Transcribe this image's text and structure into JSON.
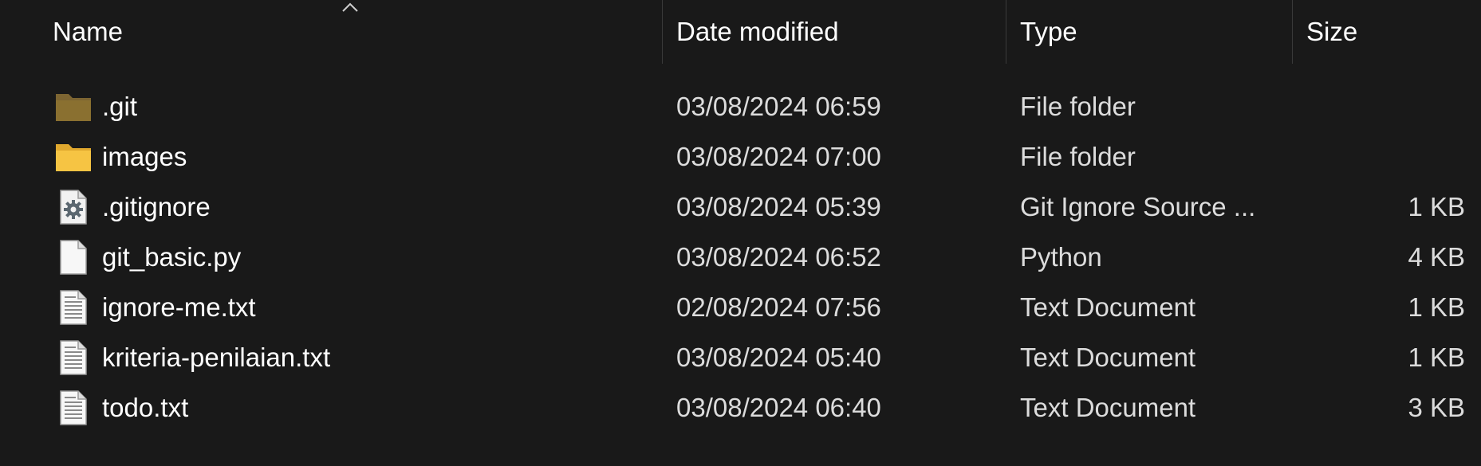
{
  "columns": {
    "name": "Name",
    "date": "Date modified",
    "type": "Type",
    "size": "Size"
  },
  "sort": {
    "column": "name",
    "direction": "ascending",
    "icon": "sort-up-chevron-icon"
  },
  "files": [
    {
      "name": ".git",
      "date": "03/08/2024 06:59",
      "type": "File folder",
      "size": "",
      "icon": "folder-dimmed-icon"
    },
    {
      "name": "images",
      "date": "03/08/2024 07:00",
      "type": "File folder",
      "size": "",
      "icon": "folder-icon"
    },
    {
      "name": ".gitignore",
      "date": "03/08/2024 05:39",
      "type": "Git Ignore Source ...",
      "size": "1 KB",
      "icon": "settings-file-icon"
    },
    {
      "name": "git_basic.py",
      "date": "03/08/2024 06:52",
      "type": "Python",
      "size": "4 KB",
      "icon": "blank-file-icon"
    },
    {
      "name": "ignore-me.txt",
      "date": "02/08/2024 07:56",
      "type": "Text Document",
      "size": "1 KB",
      "icon": "text-file-icon"
    },
    {
      "name": "kriteria-penilaian.txt",
      "date": "03/08/2024 05:40",
      "type": "Text Document",
      "size": "1 KB",
      "icon": "text-file-icon"
    },
    {
      "name": "todo.txt",
      "date": "03/08/2024 06:40",
      "type": "Text Document",
      "size": "3 KB",
      "icon": "text-file-icon"
    }
  ],
  "colors": {
    "background": "#191919",
    "folder": "#f6c443",
    "folder_dimmed": "#8a7030",
    "separator": "#3a3a3a"
  }
}
